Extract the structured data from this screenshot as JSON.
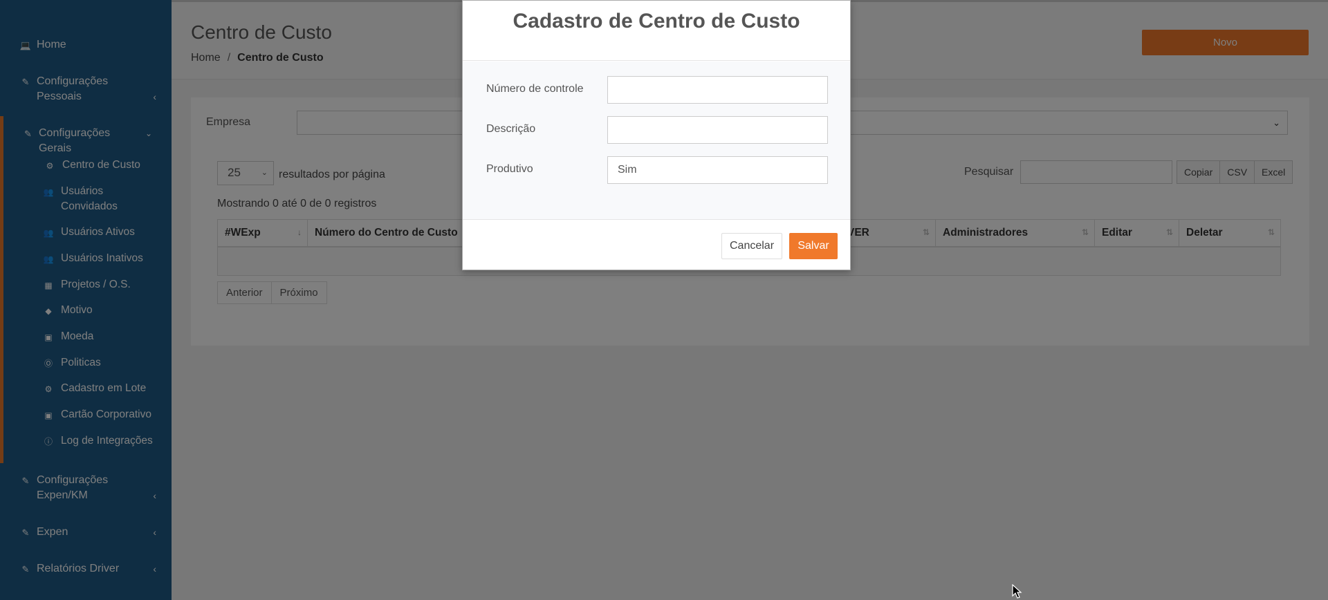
{
  "sidebar": {
    "home": "Home",
    "config_pessoais": "Configurações Pessoais",
    "config_gerais": "Configurações Gerais",
    "sub_items": [
      "Centro de Custo",
      "Usuários Convidados",
      "Usuários Ativos",
      "Usuários Inativos",
      "Projetos / O.S.",
      "Motivo",
      "Moeda",
      "Politicas",
      "Cadastro em Lote",
      "Cartão Corporativo",
      "Log de Integrações"
    ],
    "config_expen": "Configurações Expen/KM",
    "expen": "Expen",
    "relatorios": "Relatórios Driver"
  },
  "header": {
    "title": "Centro de Custo",
    "breadcrumb_home": "Home",
    "breadcrumb_sep": "/",
    "breadcrumb_current": "Centro de Custo",
    "novo_button": "Novo"
  },
  "filters": {
    "empresa_label": "Empresa",
    "page_length": "25",
    "page_length_label": "resultados por página",
    "search_label": "Pesquisar",
    "export_buttons": [
      "Copiar",
      "CSV",
      "Excel"
    ],
    "info": "Mostrando 0 até 0 de 0 registros"
  },
  "table": {
    "columns": [
      "#WExp",
      "Número do Centro de Custo",
      "",
      "VER",
      "Administradores",
      "Editar",
      "Deletar"
    ]
  },
  "pager": {
    "prev": "Anterior",
    "next": "Próximo"
  },
  "modal": {
    "title": "Cadastro de Centro de Custo",
    "fields": [
      {
        "label": "Número de controle",
        "value": ""
      },
      {
        "label": "Descrição",
        "value": ""
      },
      {
        "label": "Produtivo",
        "value": "Sim"
      }
    ],
    "cancel": "Cancelar",
    "save": "Salvar"
  },
  "colors": {
    "sidebar": "#1f5b87",
    "accent": "#f0792b"
  }
}
